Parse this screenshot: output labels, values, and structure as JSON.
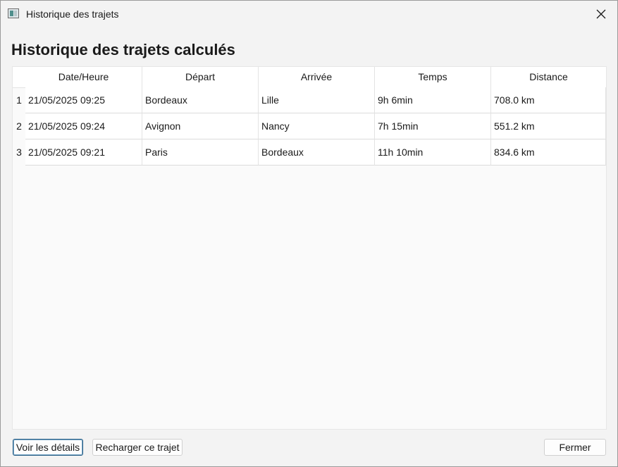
{
  "window": {
    "title": "Historique des trajets",
    "close_icon": "close-icon"
  },
  "heading": "Historique des trajets calculés",
  "table": {
    "columns": [
      "Date/Heure",
      "Départ",
      "Arrivée",
      "Temps",
      "Distance"
    ],
    "rows": [
      {
        "num": "1",
        "cells": [
          "21/05/2025 09:25",
          "Bordeaux",
          "Lille",
          "9h 6min",
          "708.0 km"
        ]
      },
      {
        "num": "2",
        "cells": [
          "21/05/2025 09:24",
          "Avignon",
          "Nancy",
          "7h 15min",
          "551.2 km"
        ]
      },
      {
        "num": "3",
        "cells": [
          "21/05/2025 09:21",
          "Paris",
          "Bordeaux",
          "11h 10min",
          "834.6 km"
        ]
      }
    ]
  },
  "buttons": {
    "details": "Voir les détails",
    "reload": "Recharger ce trajet",
    "close": "Fermer"
  },
  "colors": {
    "primary_border": "#2a5f86"
  }
}
